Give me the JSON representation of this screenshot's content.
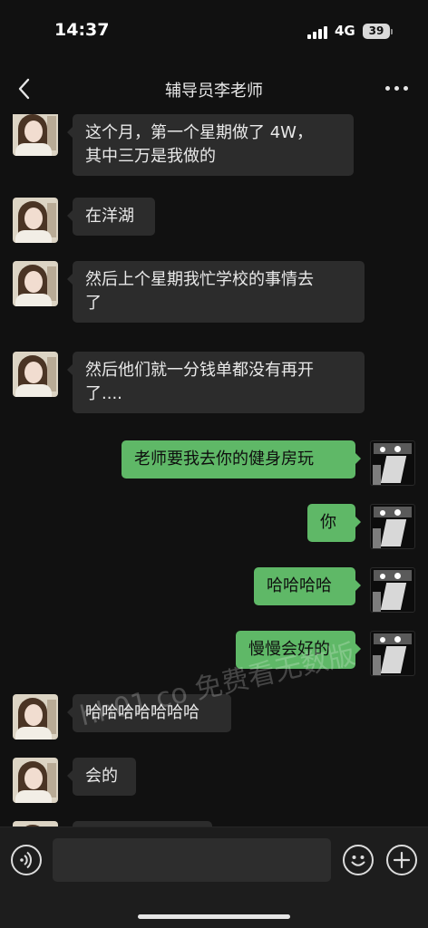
{
  "status_bar": {
    "time": "14:37",
    "network": "4G",
    "battery": "39"
  },
  "header": {
    "title": "辅导员李老师"
  },
  "messages": [
    {
      "from": "contact",
      "text": "这个月，第一个星期做了 4W，\n其中三万是我做的"
    },
    {
      "from": "contact",
      "text": "在洋湖"
    },
    {
      "from": "contact",
      "text": "然后上个星期我忙学校的事情去\n了"
    },
    {
      "from": "contact",
      "text": "然后他们就一分钱单都没有再开\n了...."
    },
    {
      "from": "me",
      "text": "老师要我去你的健身房玩"
    },
    {
      "from": "me",
      "text": "你"
    },
    {
      "from": "me",
      "text": "哈哈哈哈"
    },
    {
      "from": "me",
      "text": "慢慢会好的"
    },
    {
      "from": "contact",
      "text": "哈哈哈哈哈哈哈"
    },
    {
      "from": "contact",
      "text": "会的"
    }
  ],
  "watermark": "hh01.co 免费看无数版",
  "input": {
    "value": "",
    "placeholder": ""
  },
  "colors": {
    "background": "#111111",
    "incoming_bubble": "#2c2c2c",
    "outgoing_bubble": "#5fb867"
  },
  "icons": {
    "back": "chevron-left-icon",
    "more": "more-dots-icon",
    "voice": "voice-icon",
    "emoji": "emoji-icon",
    "plus": "plus-icon"
  }
}
